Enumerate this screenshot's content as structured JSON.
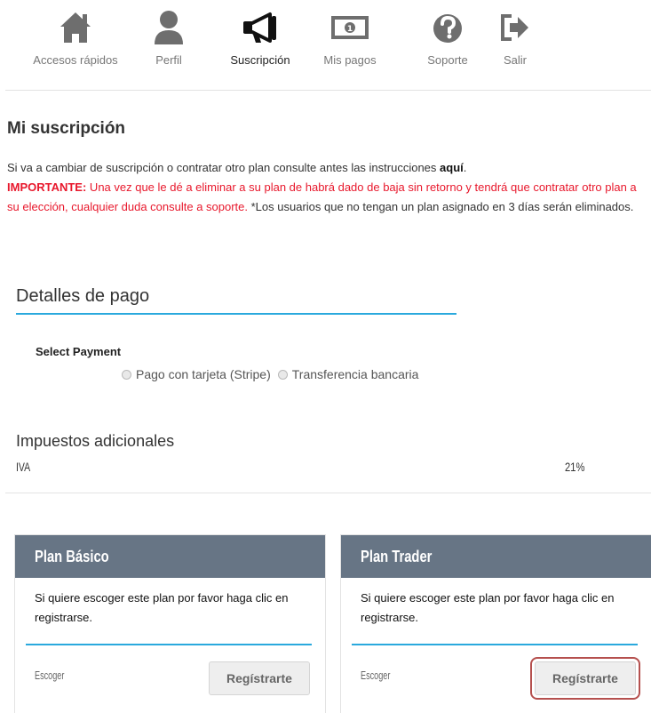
{
  "nav": {
    "items": [
      {
        "label": "Accesos rápidos",
        "icon": "home-icon"
      },
      {
        "label": "Perfil",
        "icon": "user-icon"
      },
      {
        "label": "Suscripción",
        "icon": "megaphone-icon",
        "active": true
      },
      {
        "label": "Mis pagos",
        "icon": "banknote-icon"
      },
      {
        "label": "Soporte",
        "icon": "question-circle-icon"
      },
      {
        "label": "Salir",
        "icon": "sign-out-icon"
      }
    ]
  },
  "subscription": {
    "title": "Mi suscripción",
    "intro_prefix": "Si va a cambiar de suscripción o contratar otro plan consulte antes las instrucciones ",
    "intro_link": "aquí",
    "intro_suffix": ".",
    "important_label": "IMPORTANTE:",
    "important_text": " Una vez que le dé a eliminar a su plan de habrá dado de baja sin retorno y tendrá que contratar otro plan a su elección, cualquier duda consulte a soporte.",
    "note": " *Los usuarios que no tengan un plan asignado en 3 días serán eliminados."
  },
  "payment": {
    "title": "Detalles de pago",
    "select_label": "Select Payment",
    "options": [
      "Pago con tarjeta (Stripe)",
      "Transferencia bancaria"
    ]
  },
  "taxes": {
    "title": "Impuestos adicionales",
    "name": "IVA",
    "value": "21%"
  },
  "plans": [
    {
      "name": "Plan Básico",
      "description": "Si quiere escoger este plan por favor haga clic en registrarse.",
      "choose_label": "Escoger",
      "button_label": "Regístrarte"
    },
    {
      "name": "Plan Trader",
      "description": "Si quiere escoger este plan por favor haga clic en registrarse.",
      "choose_label": "Escoger",
      "button_label": "Regístrarte"
    }
  ],
  "colors": {
    "accent": "#2aa9dd",
    "plan_header": "#677585",
    "important": "#e8182c",
    "focus_outline": "#b5504e"
  }
}
